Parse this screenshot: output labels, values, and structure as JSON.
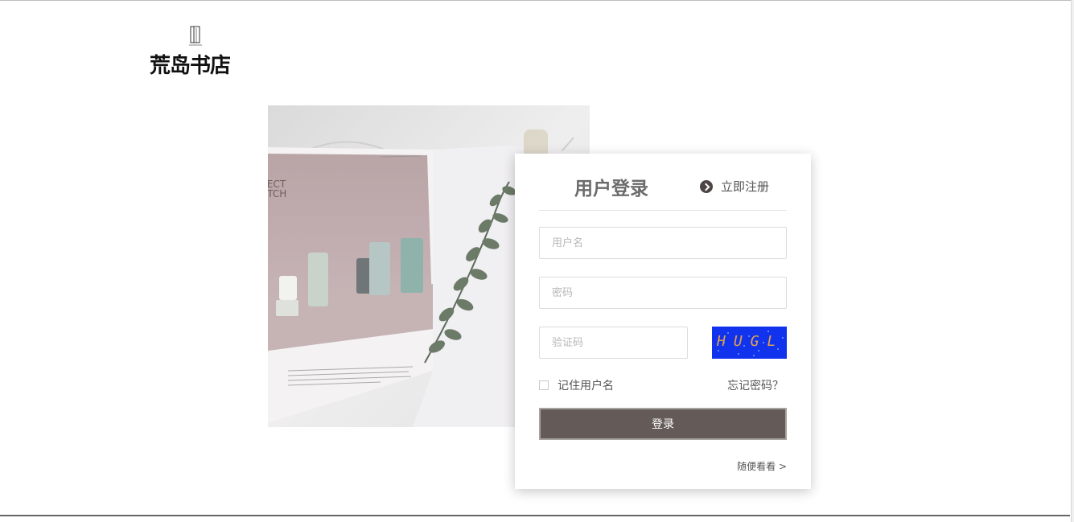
{
  "brand": {
    "name": "荒岛书店",
    "icon": "book-logo-icon"
  },
  "login": {
    "title": "用户登录",
    "register_label": "立即注册",
    "register_icon": "chevron-right-circle-icon",
    "username_placeholder": "用户名",
    "password_placeholder": "密码",
    "captcha_placeholder": "验证码",
    "captcha_text": "HUGL",
    "remember_label": "记住用户名",
    "forgot_label": "忘记密码？",
    "submit_label": "登录",
    "browse_label": "随便看看 >"
  },
  "colors": {
    "button": "#645a58",
    "captcha_bg": "#1133ee",
    "captcha_text": "#e0a050"
  }
}
